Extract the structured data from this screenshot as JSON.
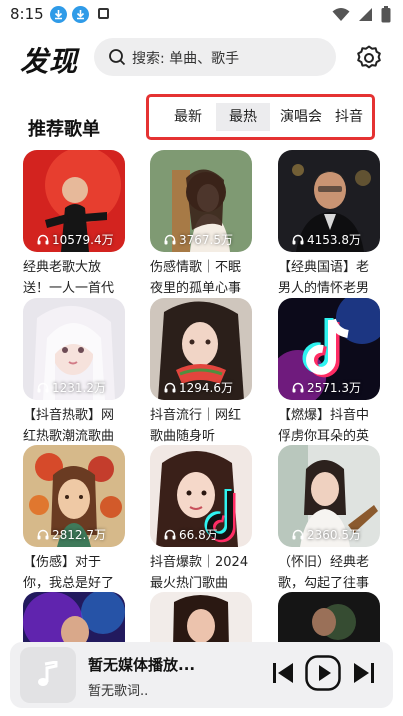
{
  "status": {
    "time": "8:15"
  },
  "header": {
    "logo": "发现",
    "search_placeholder": "搜索: 单曲、歌手"
  },
  "section": {
    "title": "推荐歌单"
  },
  "tabs": [
    {
      "label": "最新",
      "active": false
    },
    {
      "label": "最热",
      "active": true
    },
    {
      "label": "演唱会",
      "active": false
    },
    {
      "label": "抖音",
      "active": false
    }
  ],
  "playlists": [
    {
      "count": "10579.4万",
      "title": "经典老歌大放送！一人一首代"
    },
    {
      "count": "3767.5万",
      "title": "伤感情歌｜不眠夜里的孤单心事"
    },
    {
      "count": "4153.8万",
      "title": "【经典国语】老男人的情怀老男"
    },
    {
      "count": "1231.2万",
      "title": "【抖音热歌】网红热歌潮流歌曲"
    },
    {
      "count": "1294.6万",
      "title": "抖音流行｜网红歌曲随身听"
    },
    {
      "count": "2571.3万",
      "title": "【燃爆】抖音中俘虏你耳朵的英"
    },
    {
      "count": "2812.7万",
      "title": "【伤感】对于你，我总是好了"
    },
    {
      "count": "66.8万",
      "title": "抖音爆款｜2024最火热门歌曲"
    },
    {
      "count": "2360.5万",
      "title": "（怀旧）经典老歌，勾起了往事"
    },
    {
      "count": "",
      "title": ""
    },
    {
      "count": "",
      "title": ""
    },
    {
      "count": "",
      "title": ""
    }
  ],
  "player": {
    "title": "暂无媒体播放...",
    "lyric": "暂无歌词.."
  },
  "colors": {
    "accent_outline": "#e53232",
    "status_icon": "#2f9be8"
  }
}
